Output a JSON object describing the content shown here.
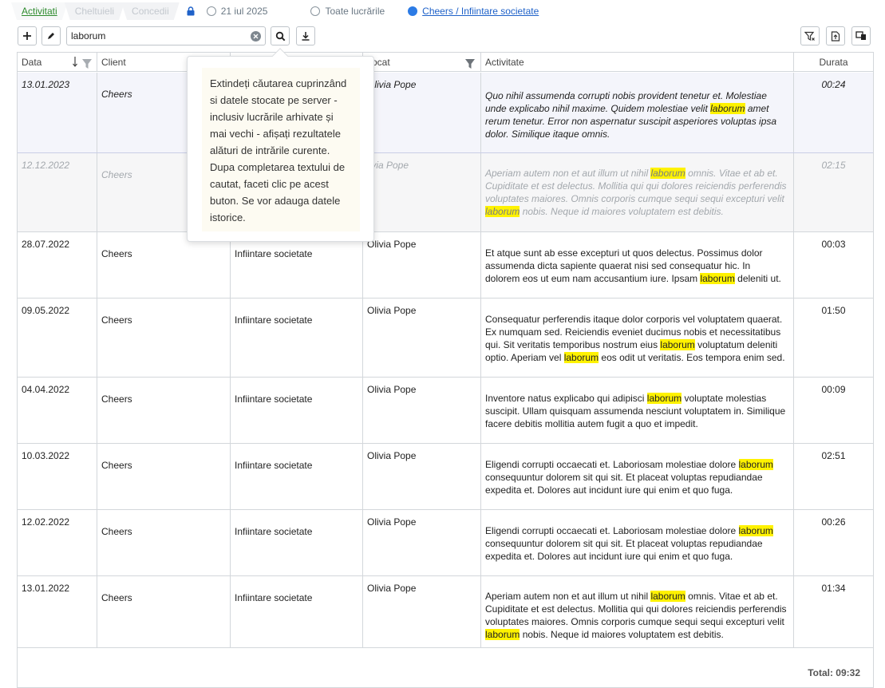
{
  "tabs": [
    {
      "label": "Activitati",
      "active": true
    },
    {
      "label": "Cheltuieli",
      "active": false
    },
    {
      "label": "Concedii",
      "active": false
    }
  ],
  "filters": {
    "date_option": "21 iul 2025",
    "all_option": "Toate lucrările",
    "selected_option": "Cheers / Infiintare societate"
  },
  "toolbar": {
    "add_icon": "plus-icon",
    "edit_icon": "pencil-icon",
    "search_value": "laborum",
    "search_icon": "magnifier-icon",
    "download_icon": "download-icon",
    "right_icons": [
      "clear-filter-icon",
      "export-icon",
      "columns-icon"
    ]
  },
  "table": {
    "headers": {
      "date": "Data",
      "client": "Client",
      "advocate": "vocat",
      "activity": "Activitate",
      "duration": "Durata"
    },
    "rows": [
      {
        "date": "13.01.2023",
        "client": "Cheers",
        "problem": "",
        "advocate": "Olivia Pope",
        "activity": [
          {
            "t": "Quo nihil assumenda corrupti nobis provident tenetur et. Molestiae unde explicabo nihil maxime. Quidem molestiae velit "
          },
          {
            "t": "laborum",
            "hl": true
          },
          {
            "t": " amet rerum tenetur. Error non aspernatur suscipit asperiores voluptas ipsa dolor. Similique itaque omnis."
          }
        ],
        "duration": "00:24"
      },
      {
        "date": "12.12.2022",
        "client": "Cheers",
        "problem": "",
        "advocate": "livia Pope",
        "activity": [
          {
            "t": "Aperiam autem non et aut illum ut nihil "
          },
          {
            "t": "laborum",
            "hl": true
          },
          {
            "t": " omnis. Vitae et ab et. Cupiditate et est delectus. Mollitia qui qui dolores reiciendis perferendis voluptates maiores. Omnis corporis cumque sequi sequi excepturi velit "
          },
          {
            "t": "laborum",
            "hl": true
          },
          {
            "t": " nobis. Neque id maiores voluptatem est debitis."
          }
        ],
        "duration": "02:15"
      },
      {
        "date": "28.07.2022",
        "client": "Cheers",
        "problem": "Infiintare societate",
        "advocate": "Olivia Pope",
        "activity": [
          {
            "t": "Et atque sunt ab esse excepturi ut quos delectus. Possimus dolor assumenda dicta sapiente quaerat nisi sed consequatur hic. In dolorem eos ut eum nam accusantium iure. Ipsam "
          },
          {
            "t": "laborum",
            "hl": true
          },
          {
            "t": " deleniti ut."
          }
        ],
        "duration": "00:03"
      },
      {
        "date": "09.05.2022",
        "client": "Cheers",
        "problem": "Infiintare societate",
        "advocate": "Olivia Pope",
        "activity": [
          {
            "t": "Consequatur perferendis itaque dolor corporis vel voluptatem quaerat. Ex numquam sed. Reiciendis eveniet ducimus nobis et necessitatibus qui. Sit veritatis temporibus nostrum eius "
          },
          {
            "t": "laborum",
            "hl": true
          },
          {
            "t": " voluptatum deleniti optio. Aperiam vel "
          },
          {
            "t": "laborum",
            "hl": true
          },
          {
            "t": " eos odit ut veritatis. Eos tempora enim sed."
          }
        ],
        "duration": "01:50"
      },
      {
        "date": "04.04.2022",
        "client": "Cheers",
        "problem": "Infiintare societate",
        "advocate": "Olivia Pope",
        "activity": [
          {
            "t": "Inventore natus explicabo qui adipisci "
          },
          {
            "t": "laborum",
            "hl": true
          },
          {
            "t": " voluptate molestias suscipit. Ullam quisquam assumenda nesciunt voluptatem in. Similique facere debitis mollitia autem fugit a quo et impedit."
          }
        ],
        "duration": "00:09"
      },
      {
        "date": "10.03.2022",
        "client": "Cheers",
        "problem": "Infiintare societate",
        "advocate": "Olivia Pope",
        "activity": [
          {
            "t": "Eligendi corrupti occaecati et. Laboriosam molestiae dolore "
          },
          {
            "t": "laborum",
            "hl": true
          },
          {
            "t": " consequuntur dolorem sit qui sit. Et placeat voluptas repudiandae expedita et. Dolores aut incidunt iure qui enim et quo fuga."
          }
        ],
        "duration": "02:51"
      },
      {
        "date": "12.02.2022",
        "client": "Cheers",
        "problem": "Infiintare societate",
        "advocate": "Olivia Pope",
        "activity": [
          {
            "t": "Eligendi corrupti occaecati et. Laboriosam molestiae dolore "
          },
          {
            "t": "laborum",
            "hl": true
          },
          {
            "t": " consequuntur dolorem sit qui sit. Et placeat voluptas repudiandae expedita et. Dolores aut incidunt iure qui enim et quo fuga."
          }
        ],
        "duration": "00:26"
      },
      {
        "date": "13.01.2022",
        "client": "Cheers",
        "problem": "Infiintare societate",
        "advocate": "Olivia Pope",
        "activity": [
          {
            "t": "Aperiam autem non et aut illum ut nihil "
          },
          {
            "t": "laborum",
            "hl": true
          },
          {
            "t": " omnis. Vitae et ab et. Cupiditate et est delectus. Mollitia qui qui dolores reiciendis perferendis voluptates maiores. Omnis corporis cumque sequi sequi excepturi velit "
          },
          {
            "t": "laborum",
            "hl": true
          },
          {
            "t": " nobis. Neque id maiores voluptatem est debitis."
          }
        ],
        "duration": "01:34"
      }
    ],
    "total": "Total: 09:32"
  },
  "tooltip": {
    "text": "Extindeți căutarea cuprinzând si datele stocate pe server - inclusiv lucrările arhivate și mai vechi - afișați rezultatele alături de intrările curente. Dupa completarea textului de cautat, faceti clic pe acest buton. Se vor adauga datele istorice."
  }
}
